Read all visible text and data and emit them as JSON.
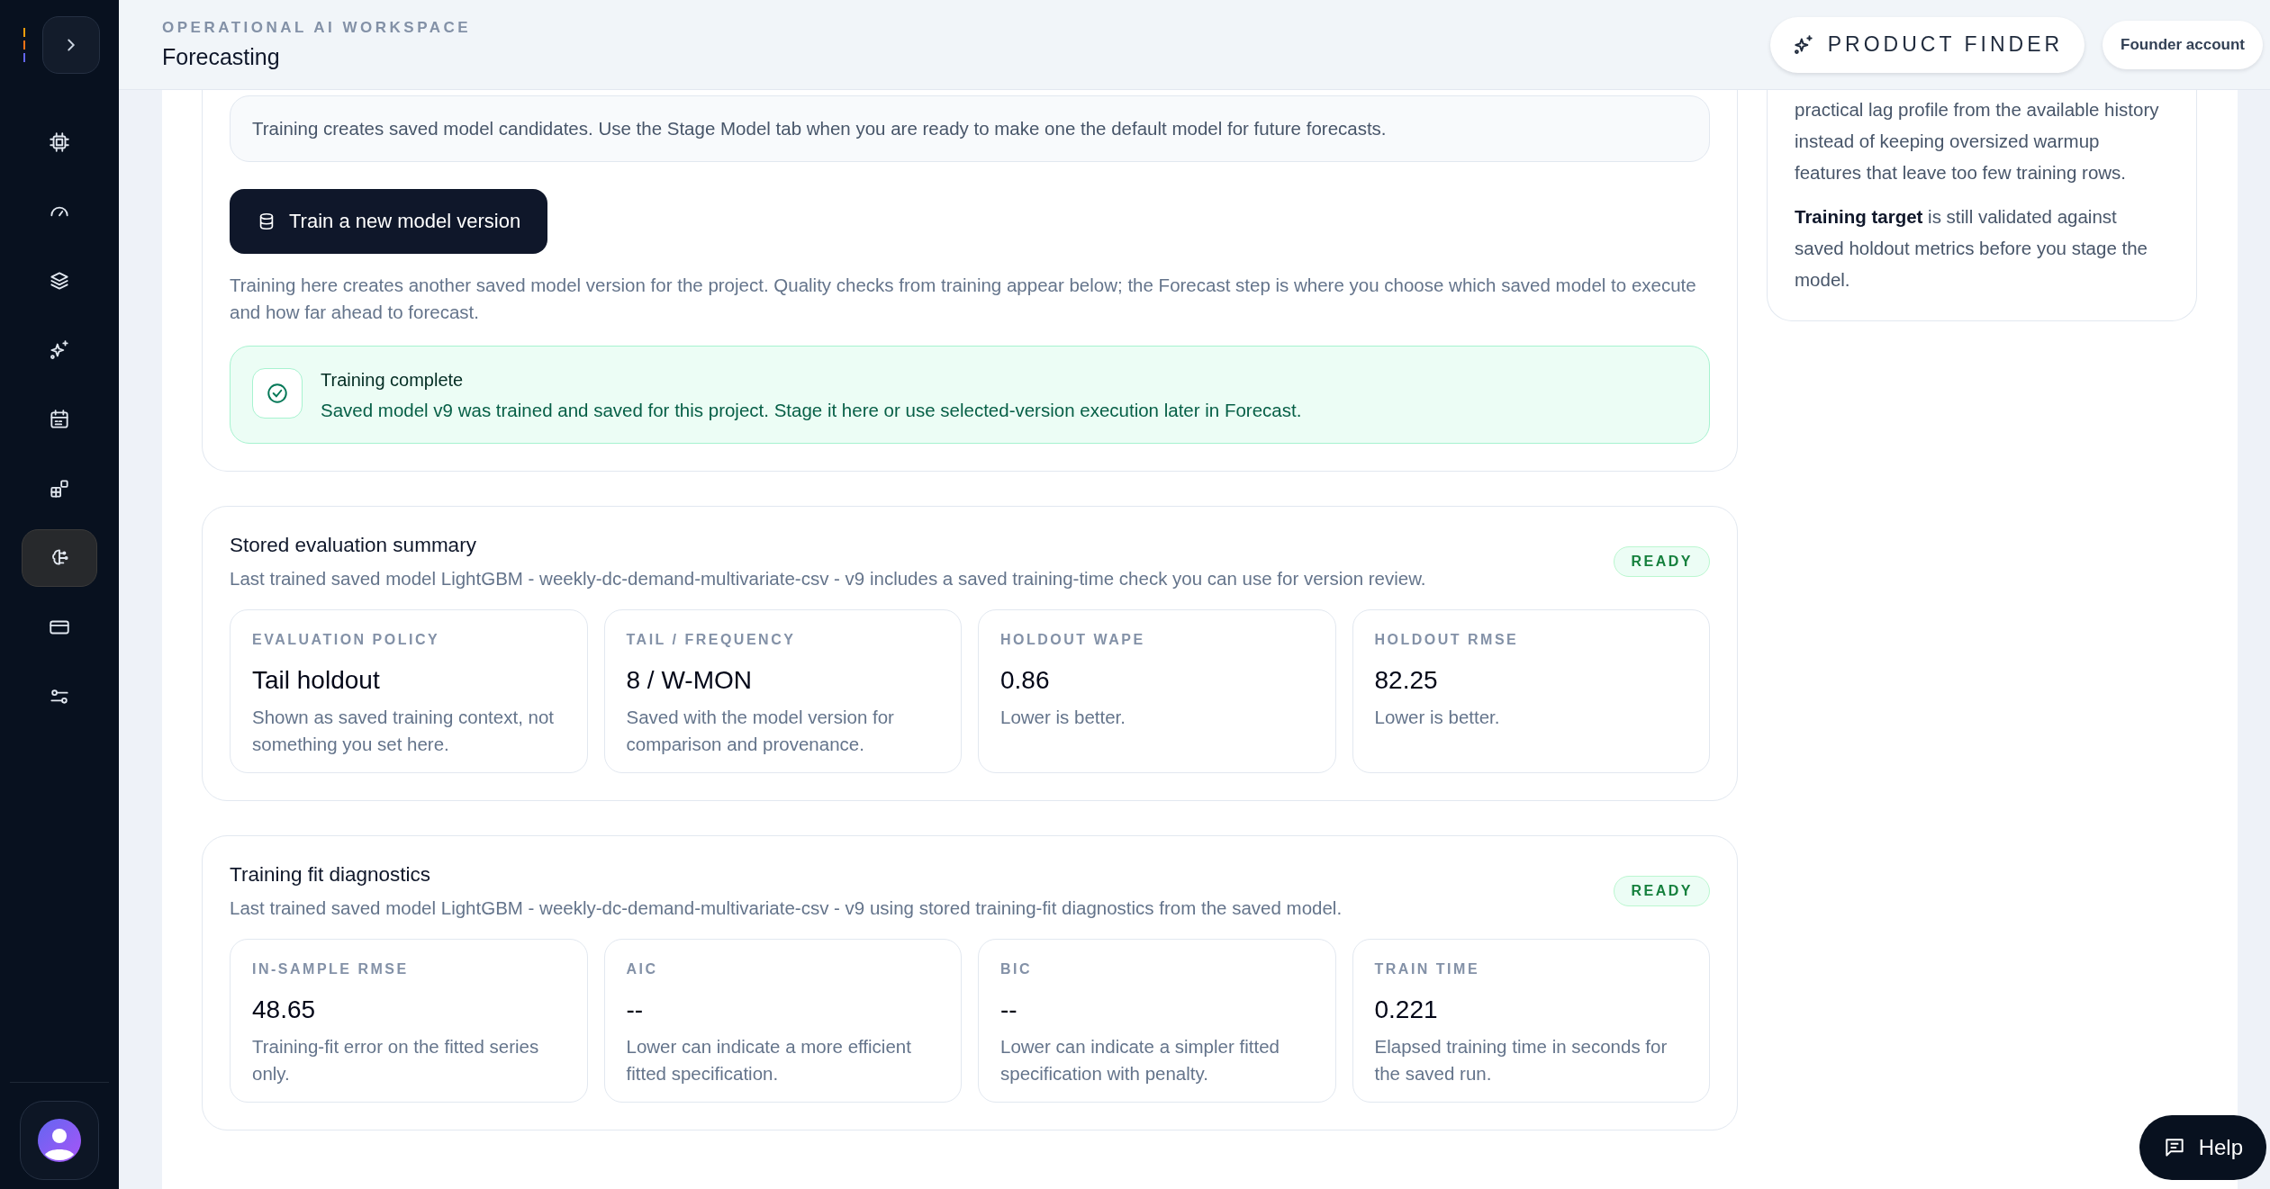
{
  "sidebar": {
    "nav_items": [
      {
        "selected": false
      },
      {
        "selected": false
      },
      {
        "selected": false
      },
      {
        "selected": false
      },
      {
        "selected": false
      },
      {
        "selected": false
      },
      {
        "selected": true
      },
      {
        "selected": false
      },
      {
        "selected": false
      }
    ]
  },
  "header": {
    "eyebrow": "OPERATIONAL AI WORKSPACE",
    "title": "Forecasting",
    "product_finder": "PRODUCT FINDER",
    "account": "Founder account"
  },
  "training": {
    "note": "Training creates saved model candidates. Use the Stage Model tab when you are ready to make one the default model for future forecasts.",
    "train_button": "Train a new model version",
    "description": "Training here creates another saved model version for the project. Quality checks from training appear below; the Forecast step is where you choose which saved model to execute and how far ahead to forecast.",
    "alert": {
      "title": "Training complete",
      "message": "Saved model v9 was trained and saved for this project. Stage it here or use selected-version execution later in Forecast."
    }
  },
  "sections": [
    {
      "title": "Stored evaluation summary",
      "subtitle": "Last trained saved model LightGBM - weekly-dc-demand-multivariate-csv - v9 includes a saved training-time check you can use for version review.",
      "badge": "READY",
      "metrics": [
        {
          "label": "EVALUATION POLICY",
          "value": "Tail holdout",
          "hint": "Shown as saved training context, not something you set here."
        },
        {
          "label": "TAIL / FREQUENCY",
          "value": "8 / W-MON",
          "hint": "Saved with the model version for comparison and provenance."
        },
        {
          "label": "HOLDOUT WAPE",
          "value": "0.86",
          "hint": "Lower is better."
        },
        {
          "label": "HOLDOUT RMSE",
          "value": "82.25",
          "hint": "Lower is better."
        }
      ]
    },
    {
      "title": "Training fit diagnostics",
      "subtitle": "Last trained saved model LightGBM - weekly-dc-demand-multivariate-csv - v9 using stored training-fit diagnostics from the saved model.",
      "badge": "READY",
      "metrics": [
        {
          "label": "IN-SAMPLE RMSE",
          "value": "48.65",
          "hint": "Training-fit error on the fitted series only."
        },
        {
          "label": "AIC",
          "value": "--",
          "hint": "Lower can indicate a more efficient fitted specification."
        },
        {
          "label": "BIC",
          "value": "--",
          "hint": "Lower can indicate a simpler fitted specification with penalty."
        },
        {
          "label": "TRAIN TIME",
          "value": "0.221",
          "hint": "Elapsed training time in seconds for the saved run."
        }
      ]
    }
  ],
  "side_panel": {
    "paragraphs": [
      "practical lag profile from the available history instead of keeping oversized warmup features that leave too few training rows.",
      "**Training target** is still validated against saved holdout metrics before you stage the model."
    ]
  },
  "help_button": "Help"
}
